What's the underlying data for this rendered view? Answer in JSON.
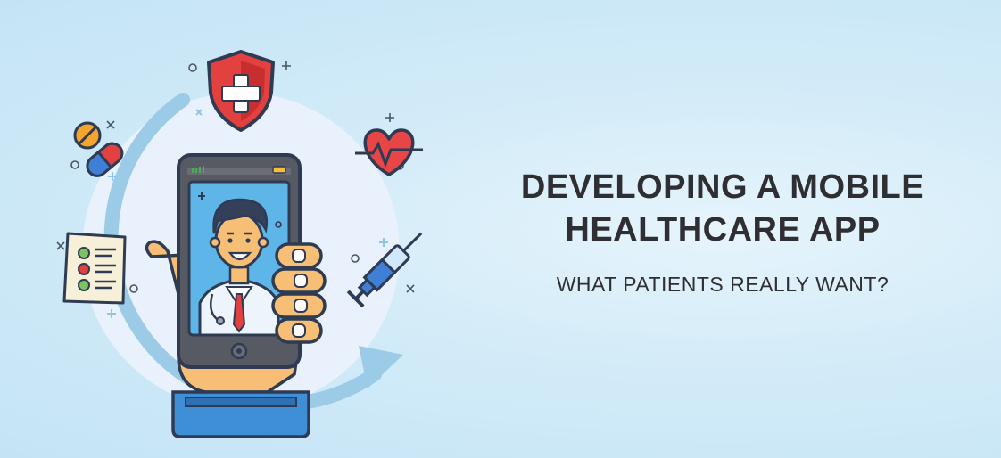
{
  "headline": {
    "line1": "DEVELOPING A MOBILE",
    "line2": "HEALTHCARE APP",
    "subtitle": "WHAT PATIENTS REALLY WANT?"
  },
  "colors": {
    "background": "#cde9f8",
    "text": "#2f2f33",
    "ring": "#8ec3e3",
    "shield_red": "#e23b3b",
    "heart_red": "#e23b3b",
    "phone_body": "#55575e",
    "screen_blue": "#5fb6e8",
    "skin": "#f7be76",
    "cuff_blue": "#3f8fd6"
  },
  "icons": [
    "shield-cross-icon",
    "heart-pulse-icon",
    "pill-icon",
    "capsule-icon",
    "checklist-icon",
    "syringe-icon",
    "doctor-avatar-icon",
    "hand-icon"
  ]
}
